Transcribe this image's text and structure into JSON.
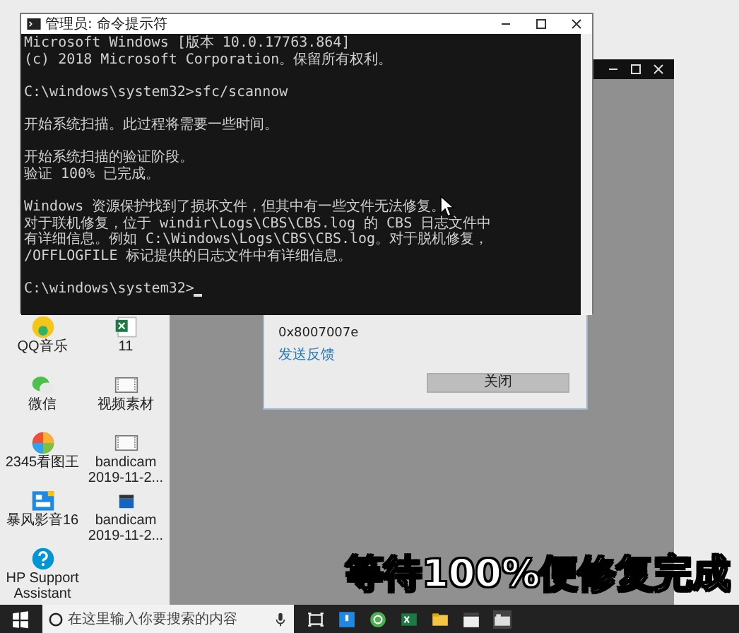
{
  "cmd_window": {
    "title": "管理员: 命令提示符",
    "paragraphs": [
      [
        "Microsoft Windows [版本 10.0.17763.864]",
        "(c) 2018 Microsoft Corporation。保留所有权利。"
      ],
      [
        "C:\\windows\\system32>sfc/scannow"
      ],
      [
        "开始系统扫描。此过程将需要一些时间。"
      ],
      [
        "开始系统扫描的验证阶段。",
        "验证 100% 已完成。"
      ],
      [
        "Windows 资源保护找到了损坏文件，但其中有一些文件无法修复。",
        "对于联机修复，位于 windir\\Logs\\CBS\\CBS.log 的 CBS 日志文件中",
        "有详细信息。例如 C:\\Windows\\Logs\\CBS\\CBS.log。对于脱机修复，",
        "/OFFLOGFILE 标记提供的日志文件中有详细信息。"
      ],
      [
        "C:\\windows\\system32>"
      ]
    ]
  },
  "error_dialog": {
    "code": "0x8007007e",
    "link": "发送反馈",
    "button": "关闭"
  },
  "desktop_icons": [
    {
      "label": "QQ音乐",
      "kind": "music"
    },
    {
      "label": "11",
      "kind": "sheet"
    },
    {
      "label": "微信",
      "kind": "chat"
    },
    {
      "label": "视频素材",
      "kind": "frame"
    },
    {
      "label": "2345看图王",
      "kind": "viewer"
    },
    {
      "label": "bandicam 2019-11-2...",
      "kind": "frame"
    },
    {
      "label": "暴风影音16",
      "kind": "player"
    },
    {
      "label": "bandicam 2019-11-2...",
      "kind": "clapper"
    },
    {
      "label": "HP Support Assistant",
      "kind": "help"
    }
  ],
  "caption": "等待100%便修复完成",
  "taskbar": {
    "search_placeholder": "在这里输入你要搜索的内容"
  }
}
